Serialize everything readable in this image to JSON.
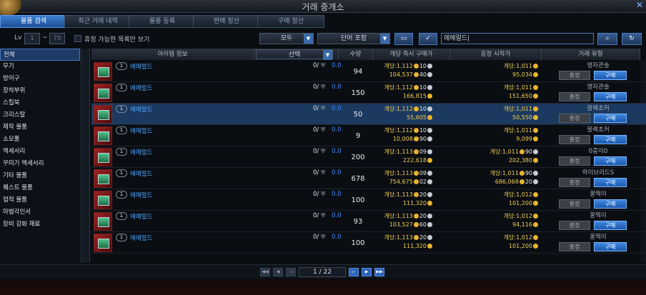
{
  "window": {
    "title": "거래 중개소",
    "close_glyph": "✕"
  },
  "tabs": [
    {
      "label": "물품 검색",
      "active": true
    },
    {
      "label": "최근 거래 내역",
      "active": false
    },
    {
      "label": "물품 등록",
      "active": false
    },
    {
      "label": "판매 정산",
      "active": false
    },
    {
      "label": "구매 정산",
      "active": false
    }
  ],
  "filter": {
    "lv_label": "Lv",
    "lv_min": "1",
    "range_sep": "~",
    "lv_max": "70",
    "checkbox_label": "휴정 가능한 목록만 보기",
    "dropdown1": "모두",
    "dropdown2": "단어 포함",
    "search_value": "에메럴드|"
  },
  "sidebar": {
    "items": [
      "전체",
      "무기",
      "방어구",
      "장착부위",
      "스킬북",
      "크리스탈",
      "제작 물품",
      "소모품",
      "액세서리",
      "꾸미기 액세서리",
      "기타 물품",
      "퀘스트 물품",
      "업적 물품",
      "마법각인서",
      "장비 강화 재료"
    ]
  },
  "columns": {
    "item_info": "아이템 정보",
    "sort_select": "선택",
    "quantity": "수량",
    "buyout": "개당 즉시 구매가",
    "bid_start": "흥정 시작가",
    "trade_type": "거래 유형"
  },
  "buttons": {
    "bid": "흥정",
    "buy": "구매"
  },
  "rows": [
    {
      "lv": "1",
      "name": "에메럴드",
      "qty": "0/",
      "count": "0.0",
      "amount": "94",
      "unit_a": "개당:1,112",
      "unit_b": "10",
      "total_a": "104,537",
      "total_b": "40",
      "bid_unit": "개당:1,011",
      "bid_total": "95,034",
      "seller": "영자관솔"
    },
    {
      "lv": "1",
      "name": "에메럴드",
      "qty": "0/",
      "count": "0.0",
      "amount": "150",
      "unit_a": "개당:1,112",
      "unit_b": "10",
      "total_a": "166,815",
      "total_b": "",
      "bid_unit": "개당:1,011",
      "bid_total": "151,650",
      "seller": "영자관솔"
    },
    {
      "lv": "1",
      "name": "에메럴드",
      "qty": "0/",
      "count": "0.0",
      "amount": "50",
      "unit_a": "개당:1,112",
      "unit_b": "10",
      "total_a": "55,605",
      "total_b": "",
      "bid_unit": "개당:1,011",
      "bid_total": "50,550",
      "seller": "블랙초커"
    },
    {
      "lv": "1",
      "name": "에메럴드",
      "qty": "0/",
      "count": "0.0",
      "amount": "9",
      "unit_a": "개당:1,112",
      "unit_b": "10",
      "total_a": "10,008",
      "total_b": "90",
      "bid_unit": "개당:1,011",
      "bid_total": "9,099",
      "seller": "블랙초커"
    },
    {
      "lv": "1",
      "name": "에메럴드",
      "qty": "0/",
      "count": "0.0",
      "amount": "200",
      "unit_a": "개당:1,113",
      "unit_b": "09",
      "total_a": "222,618",
      "total_b": "",
      "bid_unit": "개당:1,011",
      "bid_unit_b": "90",
      "bid_total": "202,380",
      "seller": "0콩이0"
    },
    {
      "lv": "1",
      "name": "에메럴드",
      "qty": "0/",
      "count": "0.0",
      "amount": "678",
      "unit_a": "개당:1,113",
      "unit_b": "09",
      "total_a": "754,675",
      "total_b": "02",
      "bid_unit": "개당:1,011",
      "bid_unit_b": "90",
      "bid_total": "686,068",
      "bid_total_b": "20",
      "seller": "하이브리드S"
    },
    {
      "lv": "1",
      "name": "에메럴드",
      "qty": "0/",
      "count": "0.0",
      "amount": "100",
      "unit_a": "개당:1,113",
      "unit_b": "20",
      "total_a": "111,320",
      "total_b": "",
      "bid_unit": "개당:1,012",
      "bid_total": "101,200",
      "seller": "꿀찍이"
    },
    {
      "lv": "1",
      "name": "에메럴드",
      "qty": "0/",
      "count": "0.0",
      "amount": "93",
      "unit_a": "개당:1,113",
      "unit_b": "20",
      "total_a": "103,527",
      "total_b": "60",
      "bid_unit": "개당:1,012",
      "bid_total": "94,116",
      "seller": "꿀찍이"
    },
    {
      "lv": "1",
      "name": "에메럴드",
      "qty": "0/",
      "count": "0.0",
      "amount": "100",
      "unit_a": "개당:1,113",
      "unit_b": "20",
      "total_a": "111,320",
      "total_b": "",
      "bid_unit": "개당:1,012",
      "bid_total": "101,200",
      "seller": "꿀찍이"
    }
  ],
  "pagination": {
    "page": "1 / 22"
  }
}
